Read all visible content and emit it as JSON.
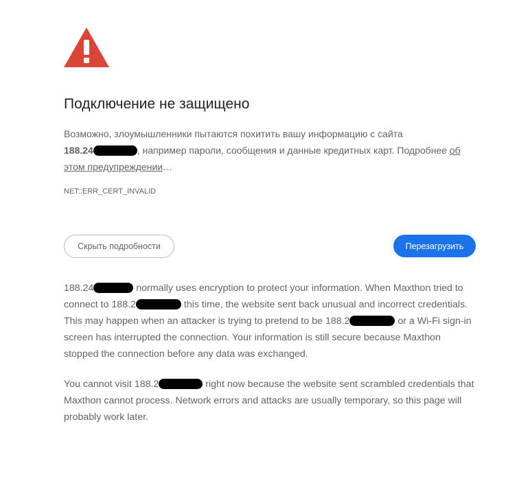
{
  "heading": "Подключение не защищено",
  "explanation": {
    "intro": "Возможно, злоумышленники пытаются похитить вашу информацию с сайта",
    "host": "188.24",
    "middle": ", например пароли, сообщения и данные кредитных карт. Подробнее",
    "learn_more": "об этом предупреждении",
    "ellipsis": "…"
  },
  "error_code": "NET::ERR_CERT_INVALID",
  "buttons": {
    "details": "Скрыть подробности",
    "reload": "Перезагрузить"
  },
  "details": {
    "p1_a": "188.24",
    "p1_b": "normally uses encryption to protect your information. When Maxthon tried to connect to",
    "p1_c": "188.2",
    "p1_d": "this time, the website sent back unusual and incorrect credentials. This may happen when an attacker is trying to pretend to be",
    "p1_e": "188.2",
    "p1_f": "or a Wi-Fi sign-in screen has interrupted the connection. Your information is still secure because Maxthon stopped the connection before any data was exchanged.",
    "p2_a": "You cannot visit",
    "p2_b": "188.2",
    "p2_c": "right now because the website sent scrambled credentials that Maxthon cannot process. Network errors and attacks are usually temporary, so this page will probably work later."
  },
  "colors": {
    "warning_icon": "#db4437",
    "primary_button": "#1a73e8",
    "redaction": "#000000"
  },
  "icons": {
    "warning": "warning-triangle-icon"
  }
}
